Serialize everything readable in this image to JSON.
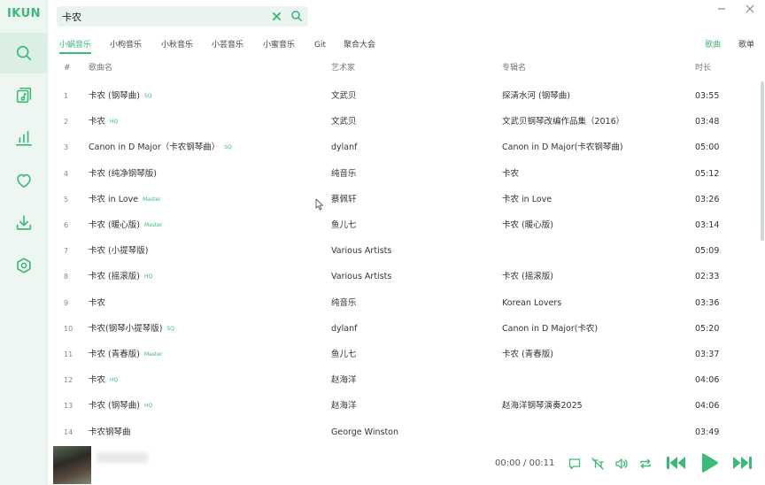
{
  "app": {
    "logo": "IKUN"
  },
  "search": {
    "value": "卡农",
    "placeholder": ""
  },
  "colors": {
    "accent": "#3cb878",
    "sidebar_bg": "#eef6f1"
  },
  "sidebar": {
    "items": [
      {
        "icon": "search-icon",
        "active": true
      },
      {
        "icon": "music-file-icon",
        "active": false
      },
      {
        "icon": "chart-bars-icon",
        "active": false
      },
      {
        "icon": "heart-icon",
        "active": false
      },
      {
        "icon": "download-icon",
        "active": false
      },
      {
        "icon": "settings-hexagon-icon",
        "active": false
      }
    ]
  },
  "sources": {
    "tabs": [
      "小蜗音乐",
      "小枸音乐",
      "小秋音乐",
      "小芸音乐",
      "小蜜音乐",
      "Git",
      "聚合大会"
    ],
    "active": 0
  },
  "types": {
    "tabs": [
      "歌曲",
      "歌单"
    ],
    "active": 0
  },
  "table": {
    "headers": {
      "num": "#",
      "name": "歌曲名",
      "artist": "艺术家",
      "album": "专辑名",
      "duration": "时长"
    },
    "rows": [
      {
        "num": "1",
        "name": "卡农 (钢琴曲)",
        "quality": "SQ",
        "artist": "文武贝",
        "album": "探清水河 (钢琴曲)",
        "duration": "03:55"
      },
      {
        "num": "2",
        "name": "卡农",
        "quality": "HQ",
        "artist": "文武贝",
        "album": "文武贝钢琴改编作品集（2016）",
        "duration": "03:48"
      },
      {
        "num": "3",
        "name": "Canon in D Major（卡农钢琴曲）",
        "quality": "SQ",
        "artist": "dylanf",
        "album": "Canon in D Major(卡农钢琴曲)",
        "duration": "05:00"
      },
      {
        "num": "4",
        "name": "卡农 (纯净钢琴版)",
        "quality": "",
        "artist": "纯音乐",
        "album": "卡农",
        "duration": "05:12"
      },
      {
        "num": "5",
        "name": "卡农 in Love",
        "quality": "Master",
        "artist": "蔡佩轩",
        "album": "卡农 in Love",
        "duration": "03:26"
      },
      {
        "num": "6",
        "name": "卡农 (暖心版)",
        "quality": "Master",
        "artist": "鱼儿七",
        "album": "卡农 (暖心版)",
        "duration": "03:14"
      },
      {
        "num": "7",
        "name": "卡农 (小提琴版)",
        "quality": "",
        "artist": "Various Artists",
        "album": "",
        "duration": "05:09"
      },
      {
        "num": "8",
        "name": "卡农 (摇滚版)",
        "quality": "HQ",
        "artist": "Various Artists",
        "album": "卡农 (摇滚版)",
        "duration": "02:33"
      },
      {
        "num": "9",
        "name": "卡农",
        "quality": "",
        "artist": "纯音乐",
        "album": "Korean Lovers",
        "duration": "03:36"
      },
      {
        "num": "10",
        "name": "卡农(钢琴小提琴版)",
        "quality": "SQ",
        "artist": "dylanf",
        "album": "Canon in D Major(卡农)",
        "duration": "05:20"
      },
      {
        "num": "11",
        "name": "卡农 (青春版)",
        "quality": "Master",
        "artist": "鱼儿七",
        "album": "卡农 (青春版)",
        "duration": "03:37"
      },
      {
        "num": "12",
        "name": "卡农",
        "quality": "HQ",
        "artist": "赵海洋",
        "album": "",
        "duration": "04:06"
      },
      {
        "num": "13",
        "name": "卡农 (钢琴曲)",
        "quality": "HQ",
        "artist": "赵海洋",
        "album": "赵海洋钢琴演奏2025",
        "duration": "04:06"
      },
      {
        "num": "14",
        "name": "卡农钢琴曲",
        "quality": "",
        "artist": "George Winston",
        "album": "",
        "duration": "03:49"
      }
    ]
  },
  "player": {
    "current_time": "00:00",
    "separator": "/",
    "total_time": "00:11"
  }
}
